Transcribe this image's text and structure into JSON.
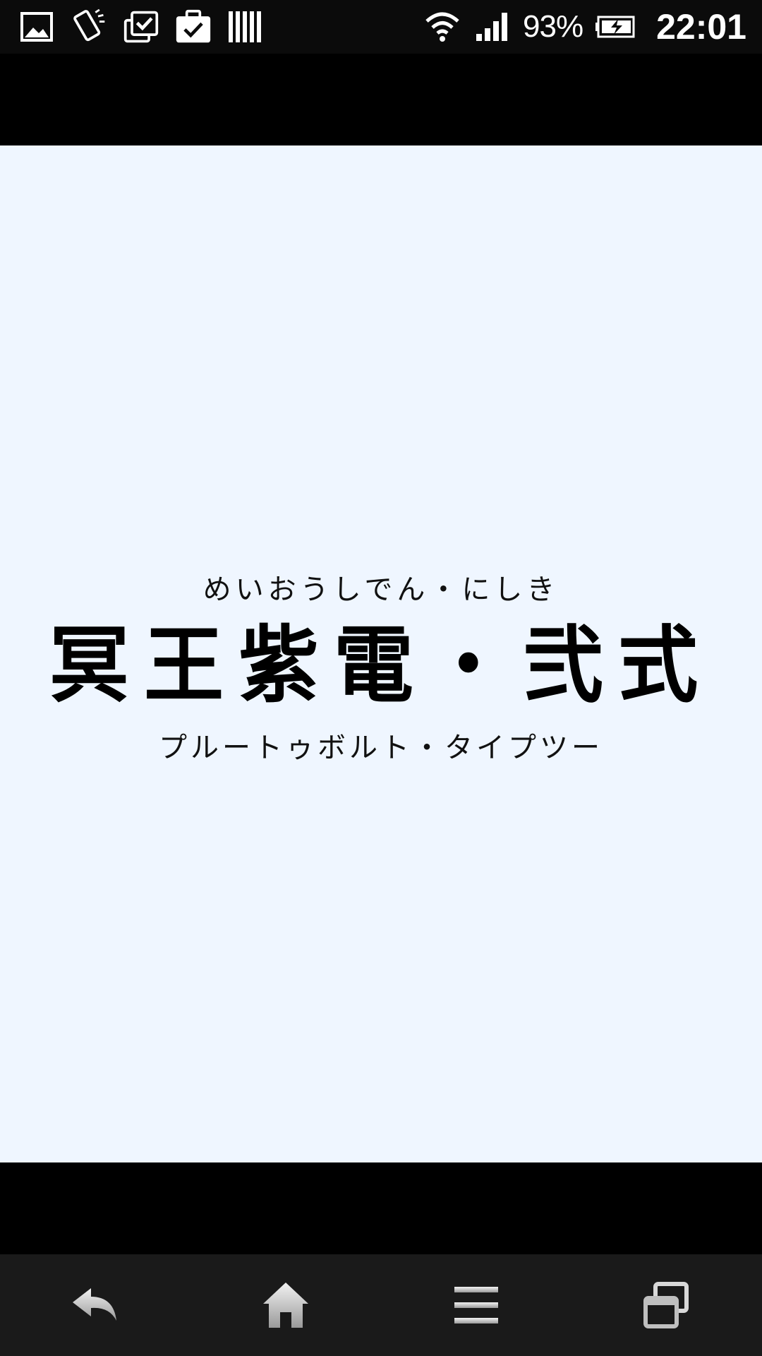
{
  "status_bar": {
    "battery": "93%",
    "time": "22:01",
    "icons_left": [
      "gallery-icon",
      "screen-rotate-icon",
      "clipboard-check-icon",
      "briefcase-check-icon",
      "barcode-icon"
    ],
    "icons_right": [
      "wifi-icon",
      "signal-icon",
      "battery-charging-icon"
    ]
  },
  "content": {
    "furigana": "めいおうしでん・にしき",
    "title": "冥王紫電・弐式",
    "subtitle": "プルートゥボルト・タイプツー",
    "background_color": "#eff6ff"
  },
  "nav_bar": {
    "buttons": [
      "back-icon",
      "home-icon",
      "menu-icon",
      "recent-apps-icon"
    ]
  }
}
